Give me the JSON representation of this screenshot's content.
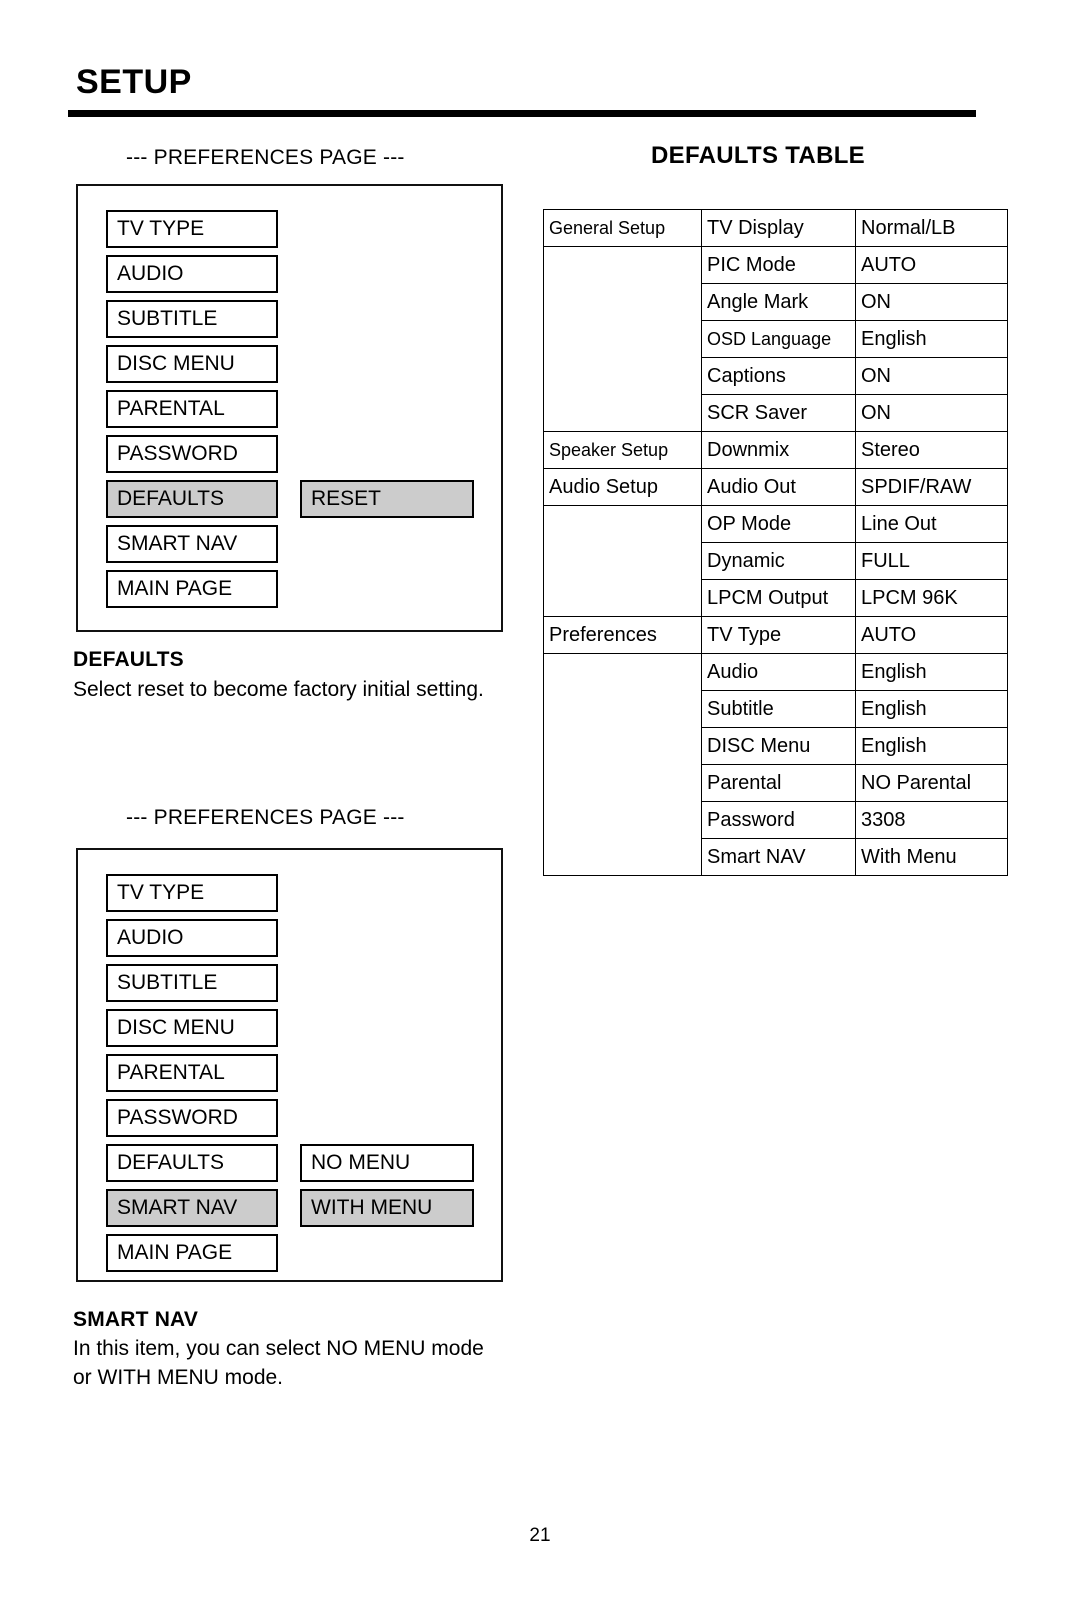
{
  "page": {
    "title": "SETUP",
    "number": "21"
  },
  "menu_one": {
    "caption": "--- PREFERENCES PAGE ---",
    "items": [
      {
        "label": "TV TYPE",
        "highlight": false
      },
      {
        "label": "AUDIO",
        "highlight": false
      },
      {
        "label": "SUBTITLE",
        "highlight": false
      },
      {
        "label": "DISC MENU",
        "highlight": false
      },
      {
        "label": "PARENTAL",
        "highlight": false
      },
      {
        "label": "PASSWORD",
        "highlight": false
      },
      {
        "label": "DEFAULTS",
        "highlight": true
      },
      {
        "label": "SMART NAV",
        "highlight": false
      },
      {
        "label": "MAIN PAGE",
        "highlight": false
      }
    ],
    "options": [
      {
        "label": "RESET",
        "highlight": true,
        "row": 6
      }
    ]
  },
  "section_one": {
    "heading": "DEFAULTS",
    "text": "Select reset to become factory initial setting."
  },
  "menu_two": {
    "caption": "--- PREFERENCES PAGE ---",
    "items": [
      {
        "label": "TV TYPE",
        "highlight": false
      },
      {
        "label": "AUDIO",
        "highlight": false
      },
      {
        "label": "SUBTITLE",
        "highlight": false
      },
      {
        "label": "DISC MENU",
        "highlight": false
      },
      {
        "label": "PARENTAL",
        "highlight": false
      },
      {
        "label": "PASSWORD",
        "highlight": false
      },
      {
        "label": "DEFAULTS",
        "highlight": false
      },
      {
        "label": "SMART NAV",
        "highlight": true
      },
      {
        "label": "MAIN PAGE",
        "highlight": false
      }
    ],
    "options": [
      {
        "label": "NO MENU",
        "highlight": false,
        "row": 6
      },
      {
        "label": "WITH MENU",
        "highlight": true,
        "row": 7
      }
    ]
  },
  "section_two": {
    "heading": "SMART NAV",
    "text": "In this item, you can select NO MENU mode or WITH MENU mode."
  },
  "defaults_table": {
    "title": "DEFAULTS TABLE",
    "rows": [
      {
        "group": "General Setup",
        "item": "TV Display",
        "value": "Normal/LB",
        "item_tight": false
      },
      {
        "group": "",
        "item": "PIC Mode",
        "value": "AUTO",
        "item_tight": false
      },
      {
        "group": "",
        "item": "Angle Mark",
        "value": "ON",
        "item_tight": false
      },
      {
        "group": "",
        "item": "OSD Language",
        "value": "English",
        "item_tight": true
      },
      {
        "group": "",
        "item": "Captions",
        "value": "ON",
        "item_tight": false
      },
      {
        "group": "",
        "item": "SCR Saver",
        "value": "ON",
        "item_tight": false
      },
      {
        "group": "Speaker Setup",
        "item": "Downmix",
        "value": "Stereo",
        "item_tight": false
      },
      {
        "group": "Audio Setup",
        "item": "Audio Out",
        "value": "SPDIF/RAW",
        "item_tight": false
      },
      {
        "group": "",
        "item": "OP Mode",
        "value": "Line Out",
        "item_tight": false
      },
      {
        "group": "",
        "item": "Dynamic",
        "value": "FULL",
        "item_tight": false
      },
      {
        "group": "",
        "item": "LPCM Output",
        "value": "LPCM 96K",
        "item_tight": false
      },
      {
        "group": "Preferences",
        "item": "TV Type",
        "value": "AUTO",
        "item_tight": false
      },
      {
        "group": "",
        "item": "Audio",
        "value": "English",
        "item_tight": false
      },
      {
        "group": "",
        "item": "Subtitle",
        "value": "English",
        "item_tight": false
      },
      {
        "group": "",
        "item": "DISC Menu",
        "value": "English",
        "item_tight": false
      },
      {
        "group": "",
        "item": "Parental",
        "value": "NO Parental",
        "item_tight": false
      },
      {
        "group": "",
        "item": "Password",
        "value": "3308",
        "item_tight": false
      },
      {
        "group": "",
        "item": "Smart NAV",
        "value": "With Menu",
        "item_tight": false
      }
    ]
  }
}
